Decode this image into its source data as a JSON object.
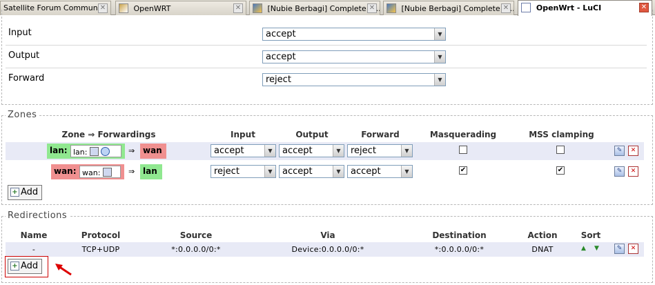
{
  "tabs": [
    {
      "label": "Satellite Forum Community ...",
      "icon": "site-icon"
    },
    {
      "label": "OpenWRT",
      "icon": "openwrt-icon"
    },
    {
      "label": "[Nubie Berbagi] Complete S...",
      "icon": "forum-icon"
    },
    {
      "label": "[Nubie Berbagi] Complete S...",
      "icon": "forum-icon"
    },
    {
      "label": "OpenWrt - LuCI",
      "icon": "document-icon"
    }
  ],
  "defaults": {
    "input_label": "Input",
    "input_value": "accept",
    "output_label": "Output",
    "output_value": "accept",
    "forward_label": "Forward",
    "forward_value": "reject"
  },
  "zones": {
    "legend": "Zones",
    "headers": {
      "zone": "Zone ⇒ Forwardings",
      "input": "Input",
      "output": "Output",
      "forward": "Forward",
      "masq": "Masquerading",
      "mss": "MSS clamping"
    },
    "rows": [
      {
        "zone": "lan:",
        "inner": "lan:",
        "target": "wan",
        "input": "accept",
        "output": "accept",
        "forward": "reject",
        "masq": "",
        "mss": ""
      },
      {
        "zone": "wan:",
        "inner": "wan:",
        "target": "lan",
        "input": "reject",
        "output": "accept",
        "forward": "accept",
        "masq": "✔",
        "mss": "✔"
      }
    ],
    "add_label": "Add",
    "colors": {
      "lan": "#90e890",
      "wan": "#f09090"
    }
  },
  "redirections": {
    "legend": "Redirections",
    "headers": {
      "name": "Name",
      "protocol": "Protocol",
      "source": "Source",
      "via": "Via",
      "destination": "Destination",
      "action": "Action",
      "sort": "Sort"
    },
    "rows": [
      {
        "name": "-",
        "protocol": "TCP+UDP",
        "source": "*:0.0.0.0/0:*",
        "via": "Device:0.0.0.0/0:*",
        "destination": "*:0.0.0.0/0:*",
        "action": "DNAT"
      }
    ],
    "add_label": "Add"
  }
}
